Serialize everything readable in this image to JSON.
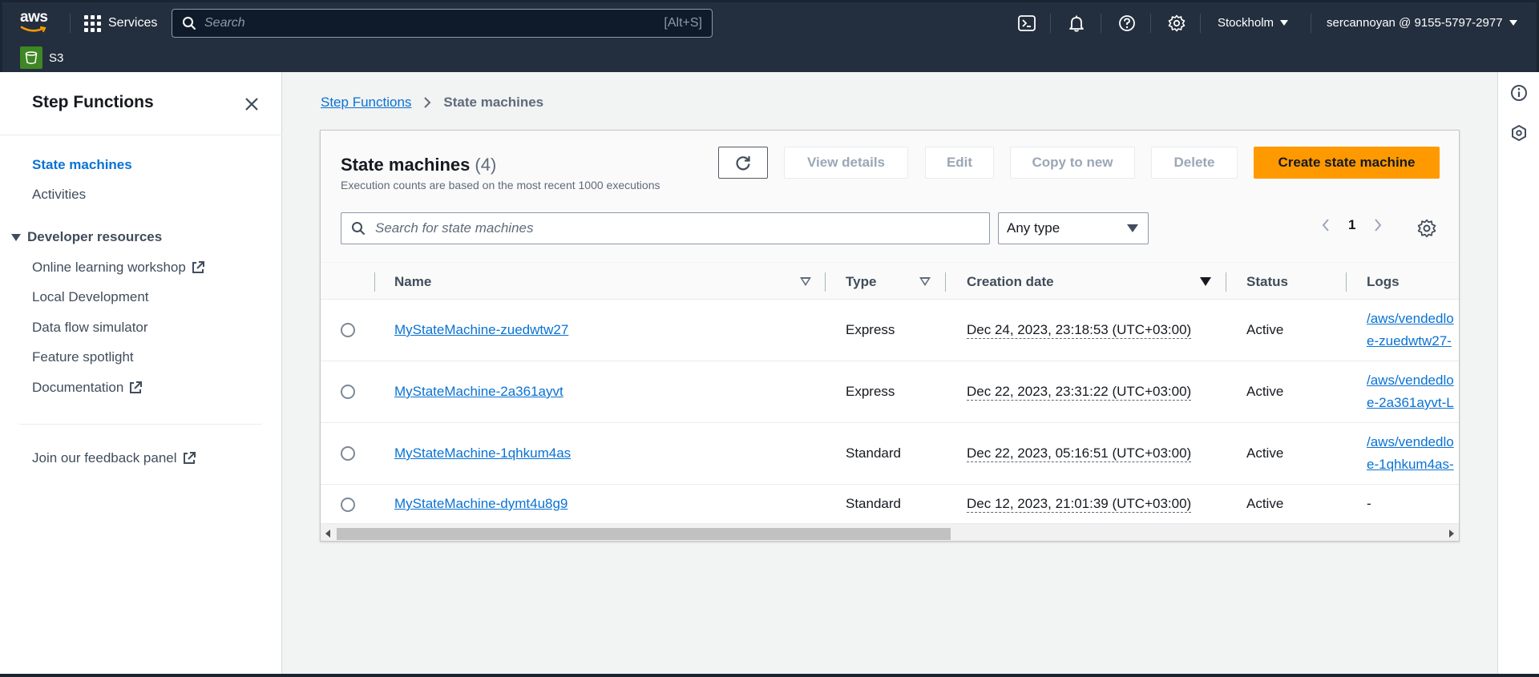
{
  "topnav": {
    "logo_text": "aws",
    "services_label": "Services",
    "search_placeholder": "Search",
    "search_shortcut": "[Alt+S]",
    "region": "Stockholm",
    "account": "sercannoyan @ 9155-5797-2977",
    "favorite_service": "S3",
    "icons": [
      "cloudshell-icon",
      "notifications-bell-icon",
      "help-icon",
      "settings-gear-icon"
    ]
  },
  "sidenav": {
    "title": "Step Functions",
    "items": [
      {
        "label": "State machines",
        "active": true
      },
      {
        "label": "Activities",
        "active": false
      }
    ],
    "section_title": "Developer resources",
    "section_items": [
      {
        "label": "Online learning workshop",
        "external": true
      },
      {
        "label": "Local Development",
        "external": false
      },
      {
        "label": "Data flow simulator",
        "external": false
      },
      {
        "label": "Feature spotlight",
        "external": false
      },
      {
        "label": "Documentation",
        "external": true
      }
    ],
    "feedback": "Join our feedback panel"
  },
  "breadcrumb": {
    "parent": "Step Functions",
    "current": "State machines"
  },
  "panel": {
    "title": "State machines",
    "count": "(4)",
    "subtitle": "Execution counts are based on the most recent 1000 executions",
    "buttons": {
      "view_details": "View details",
      "edit": "Edit",
      "copy_to_new": "Copy to new",
      "delete": "Delete",
      "create": "Create state machine"
    },
    "search_placeholder": "Search for state machines",
    "type_filter": "Any type",
    "page": "1",
    "columns": [
      "Name",
      "Type",
      "Creation date",
      "Status",
      "Logs"
    ],
    "rows": [
      {
        "name": "MyStateMachine-zuedwtw27",
        "type": "Express",
        "date": "Dec 24, 2023, 23:18:53 (UTC+03:00)",
        "status": "Active",
        "logs1": "/aws/vendedlo",
        "logs2": "e-zuedwtw27-"
      },
      {
        "name": "MyStateMachine-2a361ayvt",
        "type": "Express",
        "date": "Dec 22, 2023, 23:31:22 (UTC+03:00)",
        "status": "Active",
        "logs1": "/aws/vendedlo",
        "logs2": "e-2a361ayvt-L"
      },
      {
        "name": "MyStateMachine-1qhkum4as",
        "type": "Standard",
        "date": "Dec 22, 2023, 05:16:51 (UTC+03:00)",
        "status": "Active",
        "logs1": "/aws/vendedlo",
        "logs2": "e-1qhkum4as-"
      },
      {
        "name": "MyStateMachine-dymt4u8g9",
        "type": "Standard",
        "date": "Dec 12, 2023, 21:01:39 (UTC+03:00)",
        "status": "Active",
        "logs1": "-",
        "logs2": ""
      }
    ]
  },
  "colors": {
    "nav_bg": "#232f3e",
    "link": "#0972d3",
    "primary_button": "#ff9900",
    "s3_icon": "#3f8624"
  }
}
